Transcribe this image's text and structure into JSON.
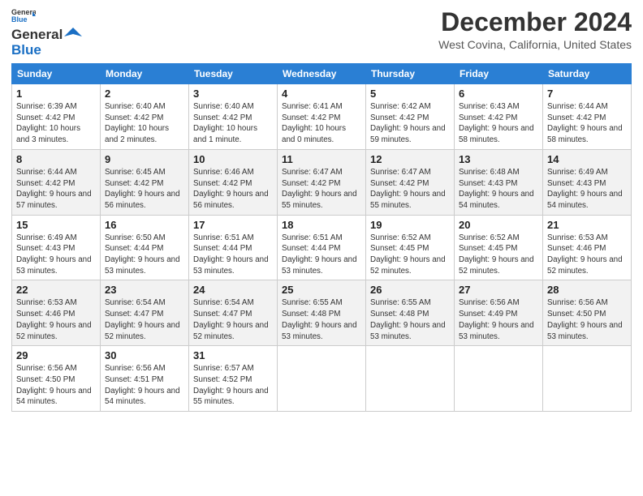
{
  "logo": {
    "line1": "General",
    "line2": "Blue",
    "icon_color": "#1a6fc4"
  },
  "header": {
    "month_title": "December 2024",
    "location": "West Covina, California, United States"
  },
  "weekdays": [
    "Sunday",
    "Monday",
    "Tuesday",
    "Wednesday",
    "Thursday",
    "Friday",
    "Saturday"
  ],
  "weeks": [
    [
      {
        "day": "1",
        "rise": "Sunrise: 6:39 AM",
        "set": "Sunset: 4:42 PM",
        "daylight": "Daylight: 10 hours and 3 minutes."
      },
      {
        "day": "2",
        "rise": "Sunrise: 6:40 AM",
        "set": "Sunset: 4:42 PM",
        "daylight": "Daylight: 10 hours and 2 minutes."
      },
      {
        "day": "3",
        "rise": "Sunrise: 6:40 AM",
        "set": "Sunset: 4:42 PM",
        "daylight": "Daylight: 10 hours and 1 minute."
      },
      {
        "day": "4",
        "rise": "Sunrise: 6:41 AM",
        "set": "Sunset: 4:42 PM",
        "daylight": "Daylight: 10 hours and 0 minutes."
      },
      {
        "day": "5",
        "rise": "Sunrise: 6:42 AM",
        "set": "Sunset: 4:42 PM",
        "daylight": "Daylight: 9 hours and 59 minutes."
      },
      {
        "day": "6",
        "rise": "Sunrise: 6:43 AM",
        "set": "Sunset: 4:42 PM",
        "daylight": "Daylight: 9 hours and 58 minutes."
      },
      {
        "day": "7",
        "rise": "Sunrise: 6:44 AM",
        "set": "Sunset: 4:42 PM",
        "daylight": "Daylight: 9 hours and 58 minutes."
      }
    ],
    [
      {
        "day": "8",
        "rise": "Sunrise: 6:44 AM",
        "set": "Sunset: 4:42 PM",
        "daylight": "Daylight: 9 hours and 57 minutes."
      },
      {
        "day": "9",
        "rise": "Sunrise: 6:45 AM",
        "set": "Sunset: 4:42 PM",
        "daylight": "Daylight: 9 hours and 56 minutes."
      },
      {
        "day": "10",
        "rise": "Sunrise: 6:46 AM",
        "set": "Sunset: 4:42 PM",
        "daylight": "Daylight: 9 hours and 56 minutes."
      },
      {
        "day": "11",
        "rise": "Sunrise: 6:47 AM",
        "set": "Sunset: 4:42 PM",
        "daylight": "Daylight: 9 hours and 55 minutes."
      },
      {
        "day": "12",
        "rise": "Sunrise: 6:47 AM",
        "set": "Sunset: 4:42 PM",
        "daylight": "Daylight: 9 hours and 55 minutes."
      },
      {
        "day": "13",
        "rise": "Sunrise: 6:48 AM",
        "set": "Sunset: 4:43 PM",
        "daylight": "Daylight: 9 hours and 54 minutes."
      },
      {
        "day": "14",
        "rise": "Sunrise: 6:49 AM",
        "set": "Sunset: 4:43 PM",
        "daylight": "Daylight: 9 hours and 54 minutes."
      }
    ],
    [
      {
        "day": "15",
        "rise": "Sunrise: 6:49 AM",
        "set": "Sunset: 4:43 PM",
        "daylight": "Daylight: 9 hours and 53 minutes."
      },
      {
        "day": "16",
        "rise": "Sunrise: 6:50 AM",
        "set": "Sunset: 4:44 PM",
        "daylight": "Daylight: 9 hours and 53 minutes."
      },
      {
        "day": "17",
        "rise": "Sunrise: 6:51 AM",
        "set": "Sunset: 4:44 PM",
        "daylight": "Daylight: 9 hours and 53 minutes."
      },
      {
        "day": "18",
        "rise": "Sunrise: 6:51 AM",
        "set": "Sunset: 4:44 PM",
        "daylight": "Daylight: 9 hours and 53 minutes."
      },
      {
        "day": "19",
        "rise": "Sunrise: 6:52 AM",
        "set": "Sunset: 4:45 PM",
        "daylight": "Daylight: 9 hours and 52 minutes."
      },
      {
        "day": "20",
        "rise": "Sunrise: 6:52 AM",
        "set": "Sunset: 4:45 PM",
        "daylight": "Daylight: 9 hours and 52 minutes."
      },
      {
        "day": "21",
        "rise": "Sunrise: 6:53 AM",
        "set": "Sunset: 4:46 PM",
        "daylight": "Daylight: 9 hours and 52 minutes."
      }
    ],
    [
      {
        "day": "22",
        "rise": "Sunrise: 6:53 AM",
        "set": "Sunset: 4:46 PM",
        "daylight": "Daylight: 9 hours and 52 minutes."
      },
      {
        "day": "23",
        "rise": "Sunrise: 6:54 AM",
        "set": "Sunset: 4:47 PM",
        "daylight": "Daylight: 9 hours and 52 minutes."
      },
      {
        "day": "24",
        "rise": "Sunrise: 6:54 AM",
        "set": "Sunset: 4:47 PM",
        "daylight": "Daylight: 9 hours and 52 minutes."
      },
      {
        "day": "25",
        "rise": "Sunrise: 6:55 AM",
        "set": "Sunset: 4:48 PM",
        "daylight": "Daylight: 9 hours and 53 minutes."
      },
      {
        "day": "26",
        "rise": "Sunrise: 6:55 AM",
        "set": "Sunset: 4:48 PM",
        "daylight": "Daylight: 9 hours and 53 minutes."
      },
      {
        "day": "27",
        "rise": "Sunrise: 6:56 AM",
        "set": "Sunset: 4:49 PM",
        "daylight": "Daylight: 9 hours and 53 minutes."
      },
      {
        "day": "28",
        "rise": "Sunrise: 6:56 AM",
        "set": "Sunset: 4:50 PM",
        "daylight": "Daylight: 9 hours and 53 minutes."
      }
    ],
    [
      {
        "day": "29",
        "rise": "Sunrise: 6:56 AM",
        "set": "Sunset: 4:50 PM",
        "daylight": "Daylight: 9 hours and 54 minutes."
      },
      {
        "day": "30",
        "rise": "Sunrise: 6:56 AM",
        "set": "Sunset: 4:51 PM",
        "daylight": "Daylight: 9 hours and 54 minutes."
      },
      {
        "day": "31",
        "rise": "Sunrise: 6:57 AM",
        "set": "Sunset: 4:52 PM",
        "daylight": "Daylight: 9 hours and 55 minutes."
      },
      null,
      null,
      null,
      null
    ]
  ]
}
